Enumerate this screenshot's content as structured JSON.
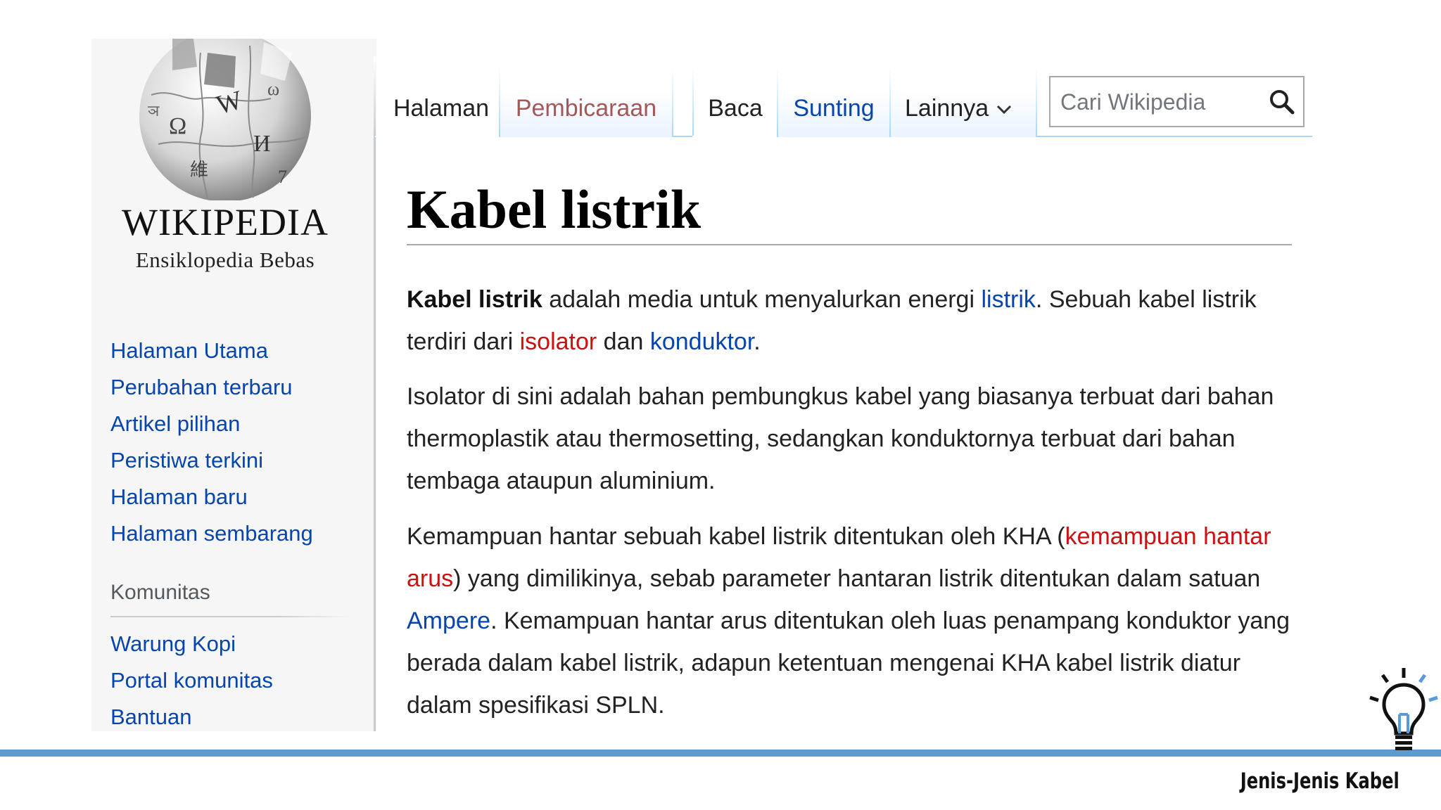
{
  "logo": {
    "wordmark": "WIKIPEDIA",
    "tagline": "Ensiklopedia Bebas"
  },
  "navigation": {
    "main": [
      {
        "label": "Halaman Utama"
      },
      {
        "label": "Perubahan terbaru"
      },
      {
        "label": "Artikel pilihan"
      },
      {
        "label": "Peristiwa terkini"
      },
      {
        "label": "Halaman baru"
      },
      {
        "label": "Halaman sembarang"
      }
    ],
    "community_heading": "Komunitas",
    "community": [
      {
        "label": "Warung Kopi"
      },
      {
        "label": "Portal komunitas"
      },
      {
        "label": "Bantuan"
      }
    ]
  },
  "tabs": {
    "page": "Halaman",
    "talk": "Pembicaraan",
    "read": "Baca",
    "edit": "Sunting",
    "more": "Lainnya"
  },
  "search": {
    "placeholder": "Cari Wikipedia",
    "value": ""
  },
  "article": {
    "title": "Kabel listrik",
    "p1": {
      "bold": "Kabel listrik",
      "t1": " adalah media untuk menyalurkan energi ",
      "link_listrik": "listrik",
      "t2": ". Sebuah kabel listrik terdiri dari ",
      "link_isolator": "isolator",
      "t3": " dan ",
      "link_konduktor": "konduktor",
      "t4": "."
    },
    "p2": "Isolator di sini adalah bahan pembungkus kabel yang biasanya terbuat dari bahan thermoplastik atau thermosetting, sedangkan konduktornya terbuat dari bahan tembaga ataupun aluminium.",
    "p3": {
      "t1": "Kemampuan hantar sebuah kabel listrik ditentukan oleh KHA (",
      "link_kha": "kemampuan hantar arus",
      "t2": ") yang dimilikinya, sebab parameter hantaran listrik ditentukan dalam satuan ",
      "link_ampere": "Ampere",
      "t3": ". Kemampuan hantar arus ditentukan oleh luas penampang konduktor yang berada dalam kabel listrik, adapun ketentuan mengenai KHA kabel listrik diatur dalam spesifikasi SPLN."
    }
  },
  "footer": {
    "caption": "Jenis-Jenis Kabel"
  },
  "colors": {
    "link": "#0645ad",
    "redlink": "#cc1111",
    "talk_tab": "#a55858",
    "tab_border": "#a7d7f9",
    "footer_bar": "#5b9bd5"
  },
  "icons": {
    "logo": "wikipedia-puzzle-globe-icon",
    "search": "search-icon",
    "more": "chevron-down-icon",
    "corner": "lightbulb-icon"
  }
}
